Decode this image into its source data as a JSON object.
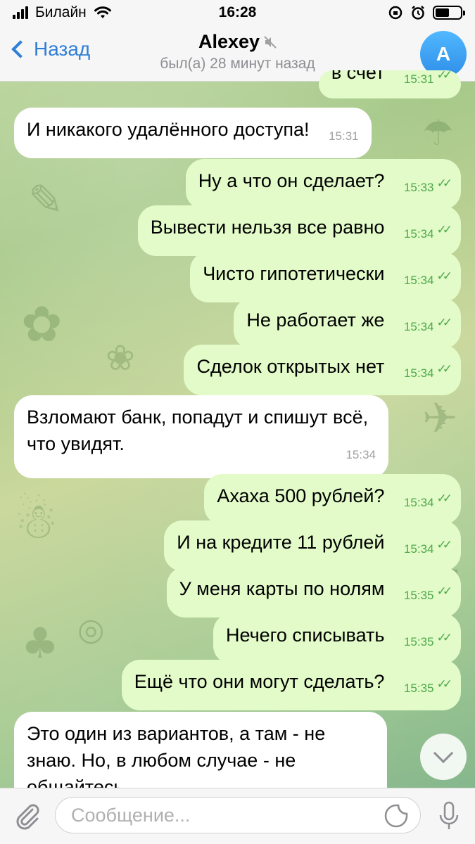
{
  "statusbar": {
    "carrier": "Билайн",
    "time": "16:28"
  },
  "header": {
    "back_label": "Назад",
    "contact_name": "Alexey",
    "last_seen": "был(а) 28 минут назад",
    "avatar_letter": "A",
    "avatar_color": "#3a9cf0"
  },
  "messages": [
    {
      "direction": "out",
      "text": "в счет",
      "time": "15:31",
      "partial": true
    },
    {
      "direction": "in",
      "text": "И никакого удалённого доступа!",
      "time": "15:31"
    },
    {
      "direction": "out",
      "text": "Ну а что он сделает?",
      "time": "15:33"
    },
    {
      "direction": "out",
      "text": "Вывести нельзя все равно",
      "time": "15:34"
    },
    {
      "direction": "out",
      "text": "Чисто гипотетически",
      "time": "15:34"
    },
    {
      "direction": "out",
      "text": "Не работает же",
      "time": "15:34"
    },
    {
      "direction": "out",
      "text": "Сделок открытых нет",
      "time": "15:34"
    },
    {
      "direction": "in",
      "text": "Взломают банк, попадут и спишут всё, что увидят.",
      "time": "15:34"
    },
    {
      "direction": "out",
      "text": "Ахаха 500 рублей?",
      "time": "15:34"
    },
    {
      "direction": "out",
      "text": "И на кредите 11 рублей",
      "time": "15:34"
    },
    {
      "direction": "out",
      "text": "У меня карты по нолям",
      "time": "15:35"
    },
    {
      "direction": "out",
      "text": "Нечего списывать",
      "time": "15:35"
    },
    {
      "direction": "out",
      "text": "Ещё что они могут сделать?",
      "time": "15:35"
    },
    {
      "direction": "in",
      "text": "Это один из вариантов, а там - не знаю. Но, в любом случае - не общайтесь",
      "time": "",
      "partial": true
    }
  ],
  "input": {
    "placeholder": "Сообщение..."
  },
  "colors": {
    "outgoing_bubble": "#e2fbc9",
    "incoming_bubble": "#ffffff",
    "accent": "#2f7ed8",
    "check_green": "#4ea94a"
  },
  "icons": {
    "back": "chevron-left-icon",
    "mute": "muted-speaker-icon",
    "attach": "paperclip-icon",
    "sticker": "sticker-icon",
    "mic": "microphone-icon",
    "scroll": "chevron-down-icon"
  }
}
